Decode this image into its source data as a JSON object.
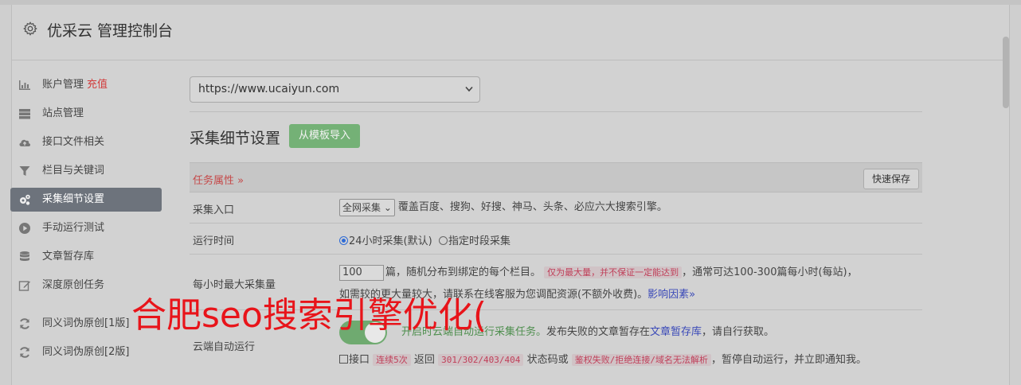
{
  "header": {
    "title": "优采云 管理控制台"
  },
  "sidebar": {
    "items": [
      {
        "label": "账户管理",
        "badge": "充值",
        "icon": "bar-chart-icon"
      },
      {
        "label": "站点管理",
        "icon": "server-icon"
      },
      {
        "label": "接口文件相关",
        "icon": "cloud-upload-icon"
      },
      {
        "label": "栏目与关键词",
        "icon": "filter-icon"
      },
      {
        "label": "采集细节设置",
        "icon": "gears-icon",
        "active": true
      },
      {
        "label": "手动运行测试",
        "icon": "play-icon"
      },
      {
        "label": "文章暂存库",
        "icon": "database-icon"
      },
      {
        "label": "深度原创任务",
        "icon": "edit-icon"
      },
      {
        "label": "同义词伪原创[1版]",
        "icon": "refresh-icon"
      },
      {
        "label": "同义词伪原创[2版]",
        "icon": "refresh-icon"
      }
    ]
  },
  "main": {
    "site_select": "https://www.ucaiyun.com",
    "section_title": "采集细节设置",
    "import_button": "从模板导入",
    "table": {
      "header_label": "任务属性 »",
      "quick_save": "快速保存",
      "rows": {
        "entry": {
          "label": "采集入口",
          "select": "全网采集",
          "desc": "覆盖百度、搜狗、好搜、神马、头条、必应六大搜索引擎。"
        },
        "runtime": {
          "label": "运行时间",
          "opt1": "24小时采集(默认)",
          "opt2": "指定时段采集"
        },
        "max": {
          "label": "每小时最大采集量",
          "value": "100",
          "t1": "篇，随机分布到绑定的每个栏目。",
          "code": "仅为最大量，并不保证一定能达到",
          "t2": "，通常可达100-300篇每小时(每站)，",
          "t3": "如需较的更大量较大，请联系在线客服为您调配资源(不额外收费)。",
          "link": "影响因素»"
        },
        "cloud": {
          "label": "云端自动运行",
          "green": "开启时云端自动运行采集任务。",
          "t1": "发布失败的文章暂存在",
          "link": "文章暂存库",
          "t2": "，请自行获取。",
          "cb": "接口",
          "code1": "连续5次",
          "t3": "返回",
          "code2": "301/302/403/404",
          "t4": "状态码或",
          "code3": "鉴权失败/拒绝连接/域名无法解析",
          "t5": "，暂停自动运行，并立即通知我。"
        }
      }
    }
  },
  "watermark": "合肥seo搜索引擎优化("
}
